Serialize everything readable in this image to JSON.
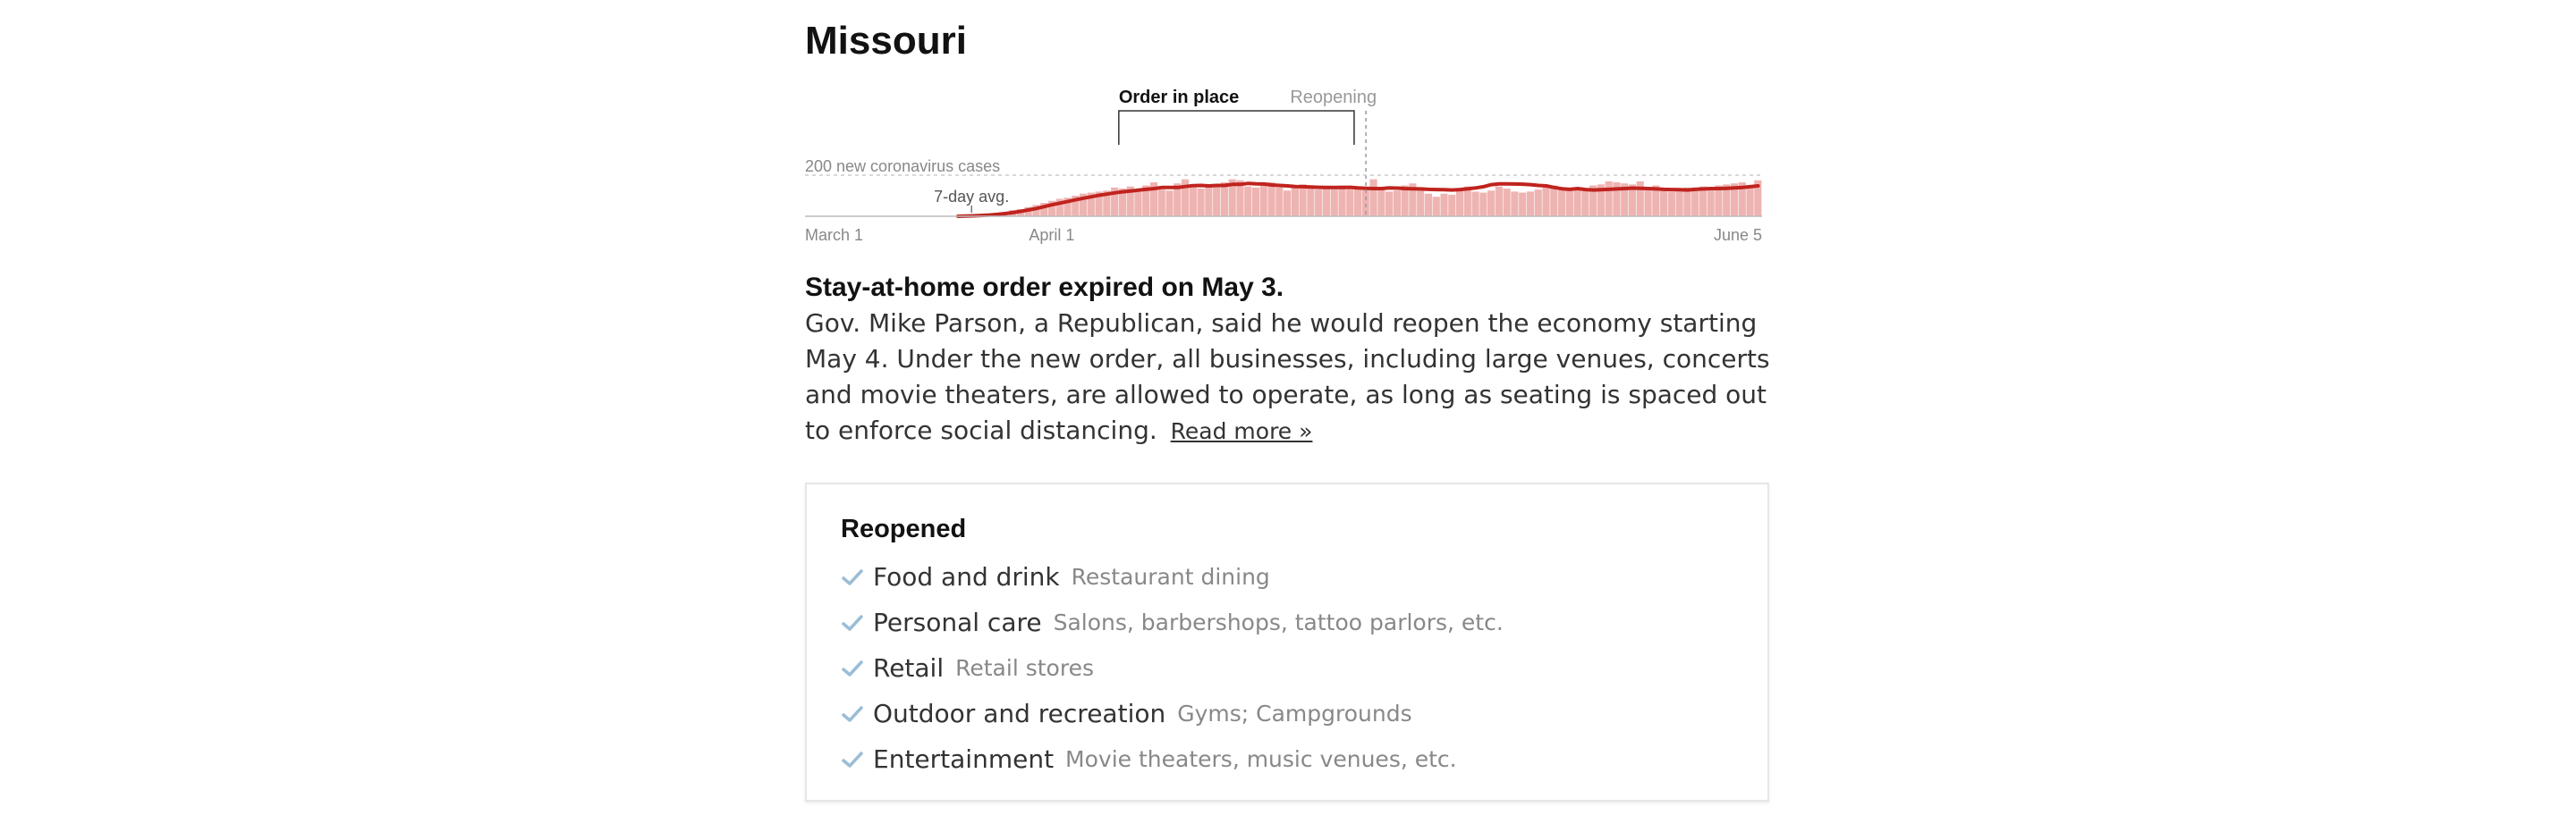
{
  "state": "Missouri",
  "chart_data": {
    "type": "bar",
    "series": [
      {
        "name": "new coronavirus cases",
        "values": [
          0,
          0,
          0,
          0,
          0,
          0,
          0,
          0,
          0,
          0,
          0,
          0,
          0,
          0,
          0,
          0,
          0,
          0,
          1,
          2,
          3,
          5,
          6,
          10,
          15,
          20,
          30,
          35,
          45,
          55,
          65,
          75,
          85,
          90,
          100,
          110,
          115,
          120,
          125,
          140,
          135,
          145,
          130,
          150,
          165,
          130,
          125,
          160,
          180,
          140,
          135,
          150,
          155,
          165,
          180,
          175,
          145,
          140,
          150,
          165,
          140,
          125,
          150,
          155,
          140,
          130,
          135,
          145,
          150,
          130,
          135,
          135,
          180,
          130,
          120,
          125,
          150,
          160,
          140,
          110,
          95,
          110,
          105,
          130,
          145,
          120,
          115,
          125,
          145,
          135,
          120,
          115,
          120,
          130,
          140,
          150,
          135,
          125,
          140,
          135,
          150,
          155,
          170,
          165,
          160,
          155,
          170,
          135,
          150,
          125,
          120,
          130,
          140,
          140,
          145,
          135,
          150,
          155,
          160,
          165,
          140,
          175
        ]
      },
      {
        "name": "7-day avg.",
        "values": [
          0,
          0,
          0,
          0,
          0,
          0,
          0,
          0,
          0,
          0,
          0,
          0,
          0,
          0,
          0,
          0,
          0,
          0,
          0,
          0,
          1,
          2,
          4,
          6,
          9,
          13,
          18,
          24,
          31,
          38,
          47,
          56,
          64,
          72,
          80,
          88,
          95,
          102,
          108,
          114,
          119,
          123,
          127,
          131,
          135,
          140,
          140,
          140,
          145,
          149,
          150,
          148,
          150,
          150,
          155,
          155,
          160,
          158,
          157,
          152,
          150,
          148,
          145,
          144,
          142,
          141,
          140,
          140,
          140,
          141,
          138,
          136,
          135,
          135,
          138,
          137,
          135,
          134,
          133,
          131,
          130,
          129,
          128,
          130,
          134,
          138,
          144,
          154,
          158,
          158,
          157,
          156,
          154,
          150,
          148,
          140,
          134,
          131,
          135,
          130,
          128,
          129,
          131,
          133,
          135,
          137,
          136,
          135,
          133,
          131,
          130,
          129,
          128,
          131,
          133,
          135,
          135,
          136,
          138,
          140,
          144,
          148
        ]
      }
    ],
    "x": [
      "March 1",
      "June 5"
    ],
    "xticks": [
      "March 1",
      "April 1",
      "June 5"
    ],
    "yreference": {
      "value": 200,
      "label": "200 new coronavirus cases"
    },
    "annotations": {
      "order_label": "Order in place",
      "reopening_label": "Reopening",
      "avg_label": "7-day avg.",
      "order_start_day": 40,
      "order_end_day": 70,
      "reopening_day": 71
    },
    "colors": {
      "bars": "#eeb4b2",
      "line": "#c0231e"
    }
  },
  "summary": {
    "headline": "Stay-at-home order expired on May 3.",
    "body": "Gov. Mike Parson, a Republican, said he would reopen the economy starting May 4. Under the new order, all businesses, including large venues, concerts and movie theaters, are allowed to operate, as long as seating is spaced out to enforce social distancing.",
    "read_more": "Read more »"
  },
  "reopened": {
    "title": "Reopened",
    "icon": "check-icon",
    "check_color": "#9bbdd6",
    "items": [
      {
        "category": "Food and drink",
        "detail": "Restaurant dining"
      },
      {
        "category": "Personal care",
        "detail": "Salons, barbershops, tattoo parlors, etc."
      },
      {
        "category": "Retail",
        "detail": "Retail stores"
      },
      {
        "category": "Outdoor and recreation",
        "detail": "Gyms; Campgrounds"
      },
      {
        "category": "Entertainment",
        "detail": "Movie theaters, music venues, etc."
      }
    ]
  }
}
